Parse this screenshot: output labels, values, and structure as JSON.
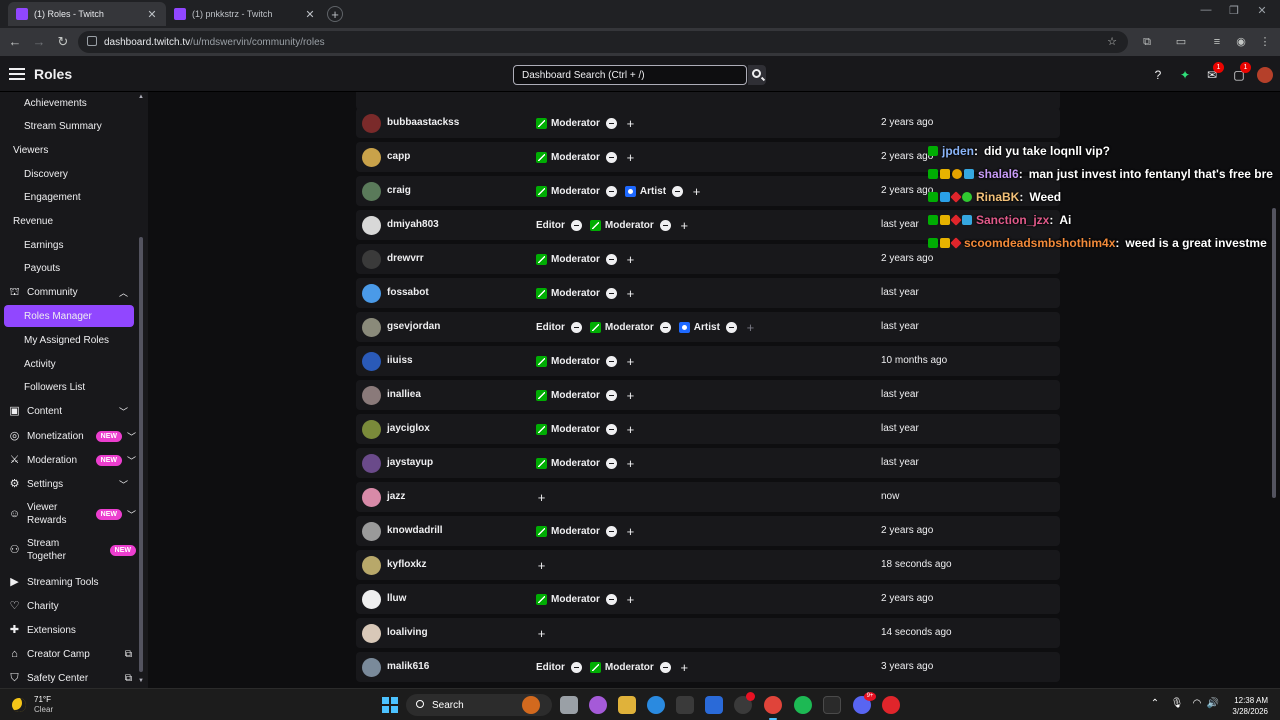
{
  "browser": {
    "tabs": [
      {
        "title": "(1) Roles - Twitch",
        "active": true
      },
      {
        "title": "(1) pnkkstrz - Twitch",
        "active": false
      }
    ],
    "url_host": "dashboard.twitch.tv",
    "url_path": "/u/mdswervin/community/roles"
  },
  "topnav": {
    "title": "Roles",
    "search_placeholder": "Dashboard Search (Ctrl + /)",
    "inbox_badge": "1",
    "whispers_badge": "1"
  },
  "sidebar": {
    "items": [
      {
        "label": "Achievements",
        "kind": "sub"
      },
      {
        "label": "Stream Summary",
        "kind": "sub"
      },
      {
        "label": "Viewers",
        "kind": "sec"
      },
      {
        "label": "Discovery",
        "kind": "sub"
      },
      {
        "label": "Engagement",
        "kind": "sub"
      },
      {
        "label": "Revenue",
        "kind": "sec"
      },
      {
        "label": "Earnings",
        "kind": "sub"
      },
      {
        "label": "Payouts",
        "kind": "sub"
      },
      {
        "label": "Community",
        "kind": "icon",
        "icon": "community-icon",
        "chev": "up"
      },
      {
        "label": "Roles Manager",
        "kind": "sub",
        "active": true
      },
      {
        "label": "My Assigned Roles",
        "kind": "sub"
      },
      {
        "label": "Activity",
        "kind": "sub"
      },
      {
        "label": "Followers List",
        "kind": "sub"
      },
      {
        "label": "Content",
        "kind": "icon",
        "icon": "content-icon",
        "chev": "down"
      },
      {
        "label": "Monetization",
        "kind": "icon",
        "icon": "monetization-icon",
        "chev": "down",
        "new": "NEW"
      },
      {
        "label": "Moderation",
        "kind": "icon",
        "icon": "moderation-icon",
        "chev": "down",
        "new": "NEW"
      },
      {
        "label": "Settings",
        "kind": "icon",
        "icon": "settings-icon",
        "chev": "down"
      },
      {
        "label": "Viewer Rewards",
        "kind": "icon",
        "icon": "viewer-rewards-icon",
        "chev": "down",
        "new": "NEW"
      },
      {
        "label": "Stream Together",
        "kind": "icon",
        "icon": "stream-together-icon",
        "new": "NEW"
      },
      {
        "label": "Streaming Tools",
        "kind": "icon",
        "icon": "streaming-tools-icon"
      },
      {
        "label": "Charity",
        "kind": "icon",
        "icon": "charity-icon"
      },
      {
        "label": "Extensions",
        "kind": "icon",
        "icon": "extensions-icon"
      },
      {
        "label": "Creator Camp",
        "kind": "icon",
        "icon": "creator-camp-icon",
        "ext": true
      },
      {
        "label": "Safety Center",
        "kind": "icon",
        "icon": "safety-center-icon",
        "ext": true
      }
    ]
  },
  "roles_table": {
    "rows": [
      {
        "user": "bubbaastackss",
        "roles": [
          "Moderator"
        ],
        "added": "2 years ago",
        "color": "#7a2a2a"
      },
      {
        "user": "capp",
        "roles": [
          "Moderator"
        ],
        "added": "2 years ago",
        "color": "#c9a24a"
      },
      {
        "user": "craig",
        "roles": [
          "Moderator",
          "Artist"
        ],
        "added": "2 years ago",
        "color": "#5a7a5a"
      },
      {
        "user": "dmiyah803",
        "roles": [
          "Editor",
          "Moderator"
        ],
        "added": "last year",
        "color": "#d8d8d8"
      },
      {
        "user": "drewvrr",
        "roles": [
          "Moderator"
        ],
        "added": "2 years ago",
        "color": "#3a3a3a"
      },
      {
        "user": "fossabot",
        "roles": [
          "Moderator"
        ],
        "added": "last year",
        "color": "#4a9ae8"
      },
      {
        "user": "gsevjordan",
        "roles": [
          "Editor",
          "Moderator",
          "Artist"
        ],
        "added": "last year",
        "color": "#8a8a7a"
      },
      {
        "user": "iiuiss",
        "roles": [
          "Moderator"
        ],
        "added": "10 months ago",
        "color": "#2a5ab8"
      },
      {
        "user": "inalliea",
        "roles": [
          "Moderator"
        ],
        "added": "last year",
        "color": "#8a7a7a"
      },
      {
        "user": "jayciglox",
        "roles": [
          "Moderator"
        ],
        "added": "last year",
        "color": "#7a8a3a"
      },
      {
        "user": "jaystayup",
        "roles": [
          "Moderator"
        ],
        "added": "last year",
        "color": "#6a4a8a"
      },
      {
        "user": "jazz",
        "roles": [],
        "added": "now",
        "color": "#d88aa8"
      },
      {
        "user": "knowdadrill",
        "roles": [
          "Moderator"
        ],
        "added": "2 years ago",
        "color": "#9a9a9a"
      },
      {
        "user": "kyfloxkz",
        "roles": [],
        "added": "18 seconds ago",
        "color": "#b8a86a"
      },
      {
        "user": "lluw",
        "roles": [
          "Moderator"
        ],
        "added": "2 years ago",
        "color": "#efefef"
      },
      {
        "user": "loaliving",
        "roles": [],
        "added": "14 seconds ago",
        "color": "#d8c8b8"
      },
      {
        "user": "malik616",
        "roles": [
          "Editor",
          "Moderator"
        ],
        "added": "3 years ago",
        "color": "#7a8a9a"
      }
    ]
  },
  "chat": {
    "messages": [
      {
        "badges": [
          "k"
        ],
        "user": "jpden",
        "color": "#8ab4f8",
        "text": "did yu take loqnll vip?"
      },
      {
        "badges": [
          "k",
          "crown",
          "coin",
          "gem"
        ],
        "user": "shalal6",
        "color": "#c89bf5",
        "text": "man just invest into fentanyl that's free bre"
      },
      {
        "badges": [
          "k",
          "arrow",
          "sword",
          "leaf"
        ],
        "user": "RinaBK",
        "color": "#f2c078",
        "text": "Weed"
      },
      {
        "badges": [
          "k",
          "crown",
          "sword",
          "gem"
        ],
        "user": "Sanction_jzx",
        "color": "#e05a8a",
        "text": "Ai"
      },
      {
        "badges": [
          "k",
          "crown",
          "sword"
        ],
        "user": "scoomdeadsmbshothim4x",
        "color": "#f28a3a",
        "text": "weed is a great investme"
      }
    ]
  },
  "taskbar": {
    "weather_temp": "71°F",
    "weather_desc": "Clear",
    "search_label": "Search",
    "time": "12:38 AM",
    "date": "3/28/2026",
    "discord_badge": "9+"
  }
}
